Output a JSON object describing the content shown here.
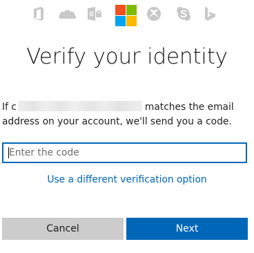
{
  "header": {
    "product_icons": [
      {
        "name": "office-icon"
      },
      {
        "name": "onedrive-icon"
      },
      {
        "name": "outlook-icon"
      },
      {
        "name": "microsoft-logo"
      },
      {
        "name": "xbox-icon"
      },
      {
        "name": "skype-icon"
      },
      {
        "name": "bing-icon"
      }
    ],
    "logo_colors": {
      "red": "#f25022",
      "green": "#7fba00",
      "blue": "#00a4ef",
      "yellow": "#ffb900"
    },
    "icon_color": "#c8c8c8"
  },
  "main": {
    "title": "Verify your identity",
    "description_prefix": "If c",
    "description_suffix": "matches the email address on your account, we'll send you a code.",
    "code_input": {
      "value": "",
      "placeholder": "Enter the code"
    },
    "alt_link": "Use a different verification option"
  },
  "buttons": {
    "cancel": "Cancel",
    "next": "Next"
  },
  "colors": {
    "accent": "#0067b8",
    "secondary_button": "#cccccc"
  }
}
